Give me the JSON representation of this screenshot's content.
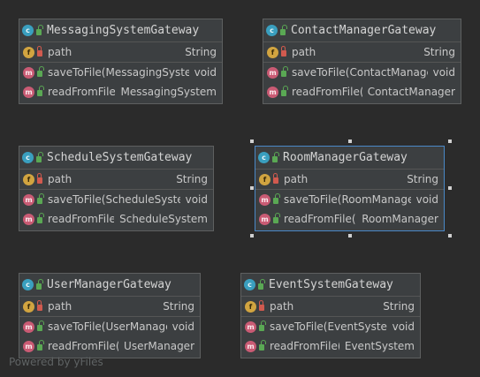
{
  "classes": [
    {
      "title": "MessagingSystemGateway",
      "field": {
        "name": "path",
        "type": "String"
      },
      "methods": [
        {
          "name": "saveToFile(MessagingSystem)",
          "type": "void"
        },
        {
          "name": "readFromFile()",
          "type": "MessagingSystem"
        }
      ]
    },
    {
      "title": "ContactManagerGateway",
      "field": {
        "name": "path",
        "type": "String"
      },
      "methods": [
        {
          "name": "saveToFile(ContactManager)",
          "type": "void"
        },
        {
          "name": "readFromFile()",
          "type": "ContactManager"
        }
      ]
    },
    {
      "title": "ScheduleSystemGateway",
      "field": {
        "name": "path",
        "type": "String"
      },
      "methods": [
        {
          "name": "saveToFile(ScheduleSystem)",
          "type": "void"
        },
        {
          "name": "readFromFile()",
          "type": "ScheduleSystem"
        }
      ]
    },
    {
      "title": "RoomManagerGateway",
      "field": {
        "name": "path",
        "type": "String"
      },
      "methods": [
        {
          "name": "saveToFile(RoomManager)",
          "type": "void"
        },
        {
          "name": "readFromFile()",
          "type": "RoomManager"
        }
      ]
    },
    {
      "title": "UserManagerGateway",
      "field": {
        "name": "path",
        "type": "String"
      },
      "methods": [
        {
          "name": "saveToFile(UserManager)",
          "type": "void"
        },
        {
          "name": "readFromFile()",
          "type": "UserManager"
        }
      ]
    },
    {
      "title": "EventSystemGateway",
      "field": {
        "name": "path",
        "type": "String"
      },
      "methods": [
        {
          "name": "saveToFile(EventSystem)",
          "type": "void"
        },
        {
          "name": "readFromFile()",
          "type": "EventSystem"
        }
      ]
    }
  ],
  "badges": {
    "class": "c",
    "field": "f",
    "method": "m"
  },
  "watermark": "Powered by yFiles",
  "colors": {
    "background": "#2b2b2b",
    "node": "#3c3f41",
    "selection": "#4a88c7"
  }
}
